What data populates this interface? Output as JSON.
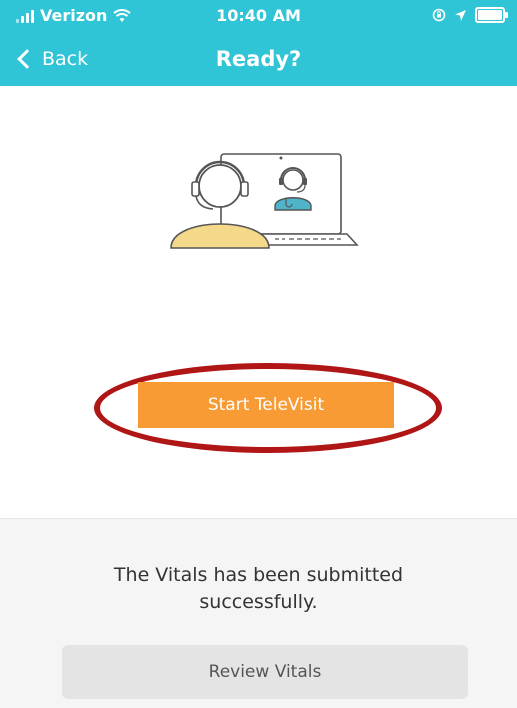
{
  "status_bar": {
    "carrier": "Verizon",
    "time": "10:40 AM"
  },
  "nav": {
    "back_label": "Back",
    "title": "Ready?"
  },
  "actions": {
    "start_label": "Start TeleVisit"
  },
  "bottom": {
    "message": "The Vitals has been submitted successfully.",
    "review_label": "Review Vitals"
  },
  "colors": {
    "header_bg": "#2fc4d6",
    "start_button": "#f89b35",
    "highlight_ring": "#b01616",
    "panel_bg": "#f5f5f5",
    "review_button": "#e4e4e4"
  }
}
